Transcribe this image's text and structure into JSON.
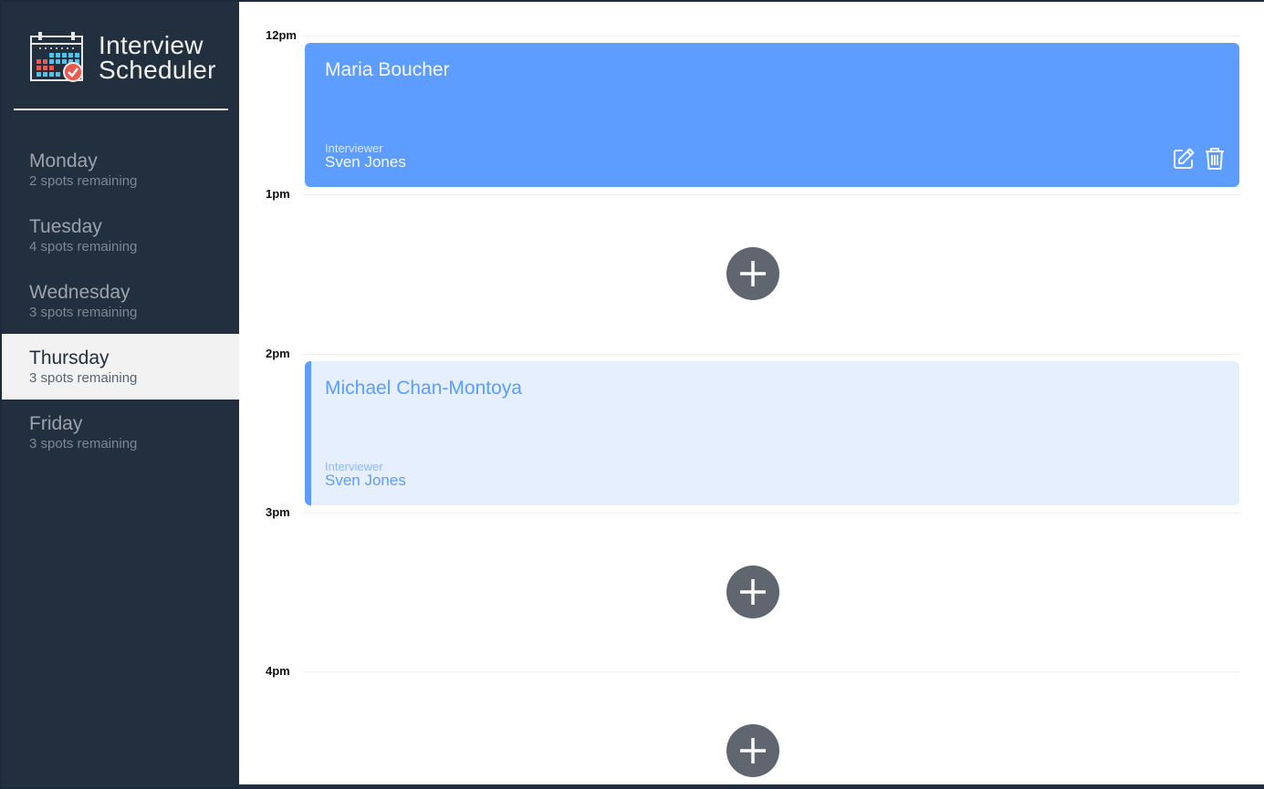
{
  "app": {
    "title_line1": "Interview",
    "title_line2": "Scheduler"
  },
  "icons": {
    "logo": "calendar-check-icon",
    "edit": "edit-icon",
    "delete": "trash-icon",
    "add": "plus-icon"
  },
  "colors": {
    "sidebar_bg": "#222f3e",
    "accent": "#5c9dff",
    "accent_light": "#e5effd",
    "add_button": "#5f666f",
    "selected_day_bg": "#f2f2f2"
  },
  "days": [
    {
      "name": "Monday",
      "spots": "2 spots remaining",
      "selected": false
    },
    {
      "name": "Tuesday",
      "spots": "4 spots remaining",
      "selected": false
    },
    {
      "name": "Wednesday",
      "spots": "3 spots remaining",
      "selected": false
    },
    {
      "name": "Thursday",
      "spots": "3 spots remaining",
      "selected": true
    },
    {
      "name": "Friday",
      "spots": "3 spots remaining",
      "selected": false
    }
  ],
  "schedule": {
    "hours": [
      "12pm",
      "1pm",
      "2pm",
      "3pm",
      "4pm"
    ],
    "appointments": [
      {
        "time": "12pm",
        "student": "Maria Boucher",
        "interviewer_label": "Interviewer",
        "interviewer": "Sven Jones",
        "state": "active"
      },
      {
        "time": "1pm",
        "empty": true
      },
      {
        "time": "2pm",
        "student": "Michael Chan-Montoya",
        "interviewer_label": "Interviewer",
        "interviewer": "Sven Jones",
        "state": "faded"
      },
      {
        "time": "3pm",
        "empty": true
      },
      {
        "time": "4pm",
        "empty": true
      }
    ]
  }
}
